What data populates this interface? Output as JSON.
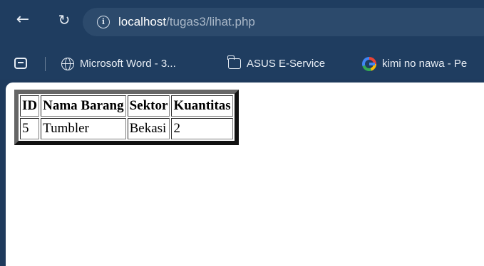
{
  "browser": {
    "url_host": "localhost",
    "url_path": "/tugas3/lihat.php",
    "back_glyph": "←",
    "reload_glyph": "↻",
    "info_glyph": "i",
    "bookmarks": [
      {
        "label": "Microsoft Word - 3...",
        "icon": "globe-icon"
      },
      {
        "label": "ASUS E-Service",
        "icon": "folder-icon"
      },
      {
        "label": "kimi no nawa - Pe",
        "icon": "google-icon"
      }
    ]
  },
  "table": {
    "headers": [
      "ID",
      "Nama Barang",
      "Sektor",
      "Kuantitas"
    ],
    "rows": [
      [
        "5",
        "Tumbler",
        "Bekasi",
        "2"
      ]
    ]
  }
}
